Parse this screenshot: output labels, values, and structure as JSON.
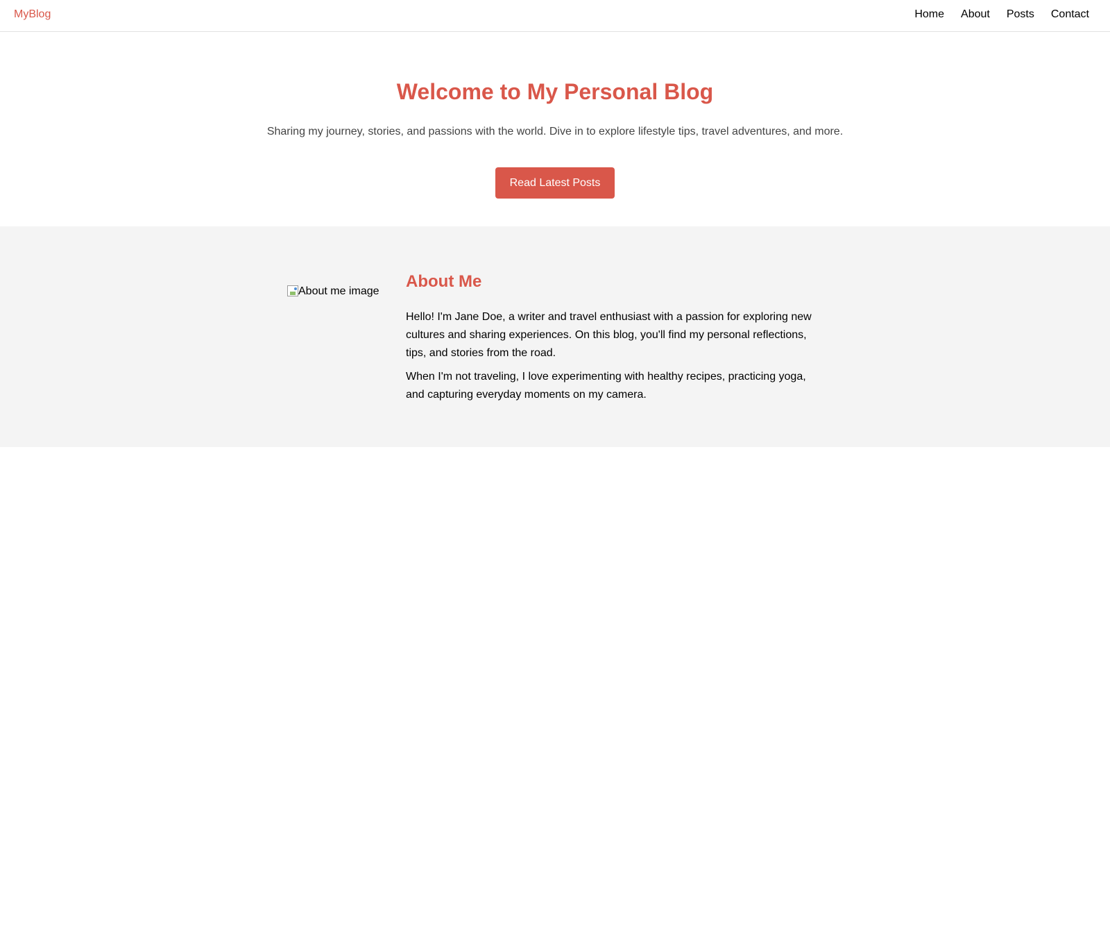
{
  "header": {
    "logo": "MyBlog",
    "nav": [
      "Home",
      "About",
      "Posts",
      "Contact"
    ]
  },
  "hero": {
    "title": "Welcome to My Personal Blog",
    "subtitle": "Sharing my journey, stories, and passions with the world. Dive in to explore lifestyle tips, travel adventures, and more.",
    "cta_label": "Read Latest Posts"
  },
  "about": {
    "image_alt": "About me image",
    "title": "About Me",
    "paragraphs": [
      "Hello! I'm Jane Doe, a writer and travel enthusiast with a passion for exploring new cultures and sharing experiences. On this blog, you'll find my personal reflections, tips, and stories from the road.",
      "When I'm not traveling, I love experimenting with healthy recipes, practicing yoga, and capturing everyday moments on my camera."
    ]
  },
  "colors": {
    "accent": "#d9574a",
    "about_background": "#f4f4f4",
    "subtitle_text": "#444444"
  }
}
